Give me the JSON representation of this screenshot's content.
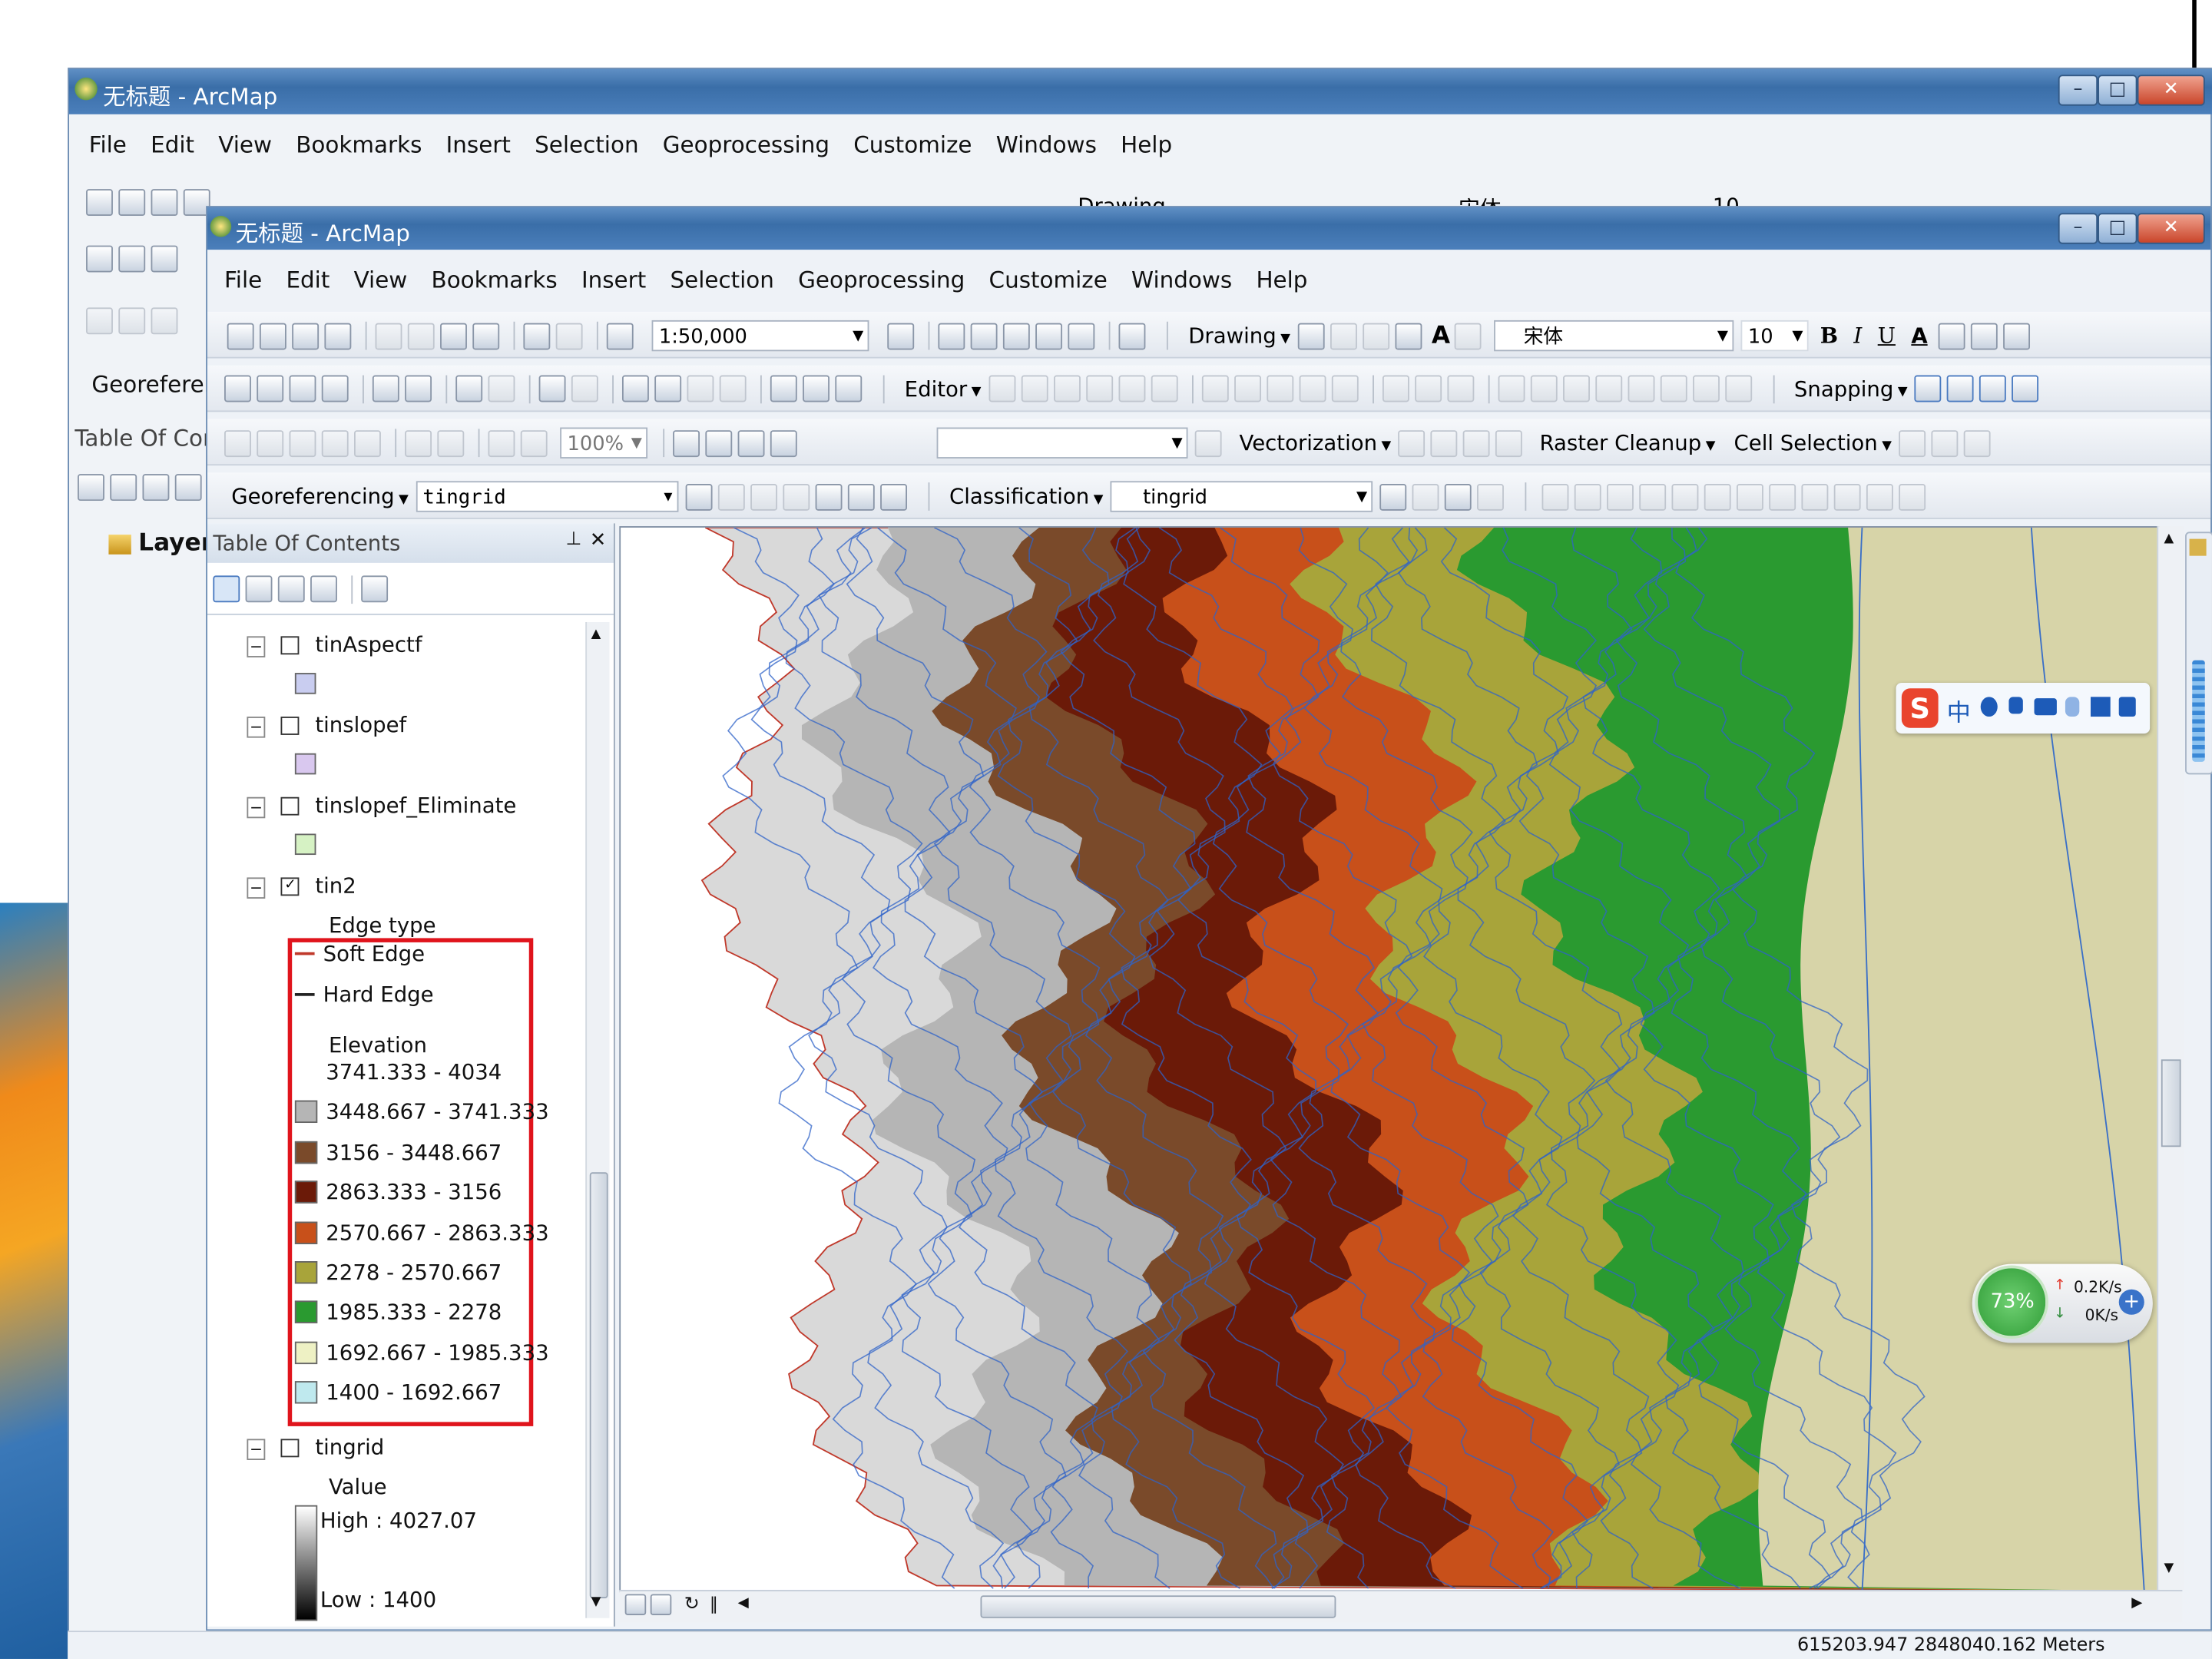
{
  "colors": {
    "title_bar": "#3a6ea8",
    "highlight_border": "#e0141c",
    "map_green": "#2f8c2a",
    "map_tan": "#d7d4a8"
  },
  "back_window": {
    "title": "无标题 - ArcMap",
    "menu": [
      "File",
      "Edit",
      "View",
      "Bookmarks",
      "Insert",
      "Selection",
      "Geoprocessing",
      "Customize",
      "Windows",
      "Help"
    ],
    "toolbar_labels": {
      "drawing": "Drawing",
      "font": "宋体",
      "size": "10"
    },
    "georef_label": "Georeferenc",
    "toc_label": "Table Of Conte",
    "layers_label": "Layers"
  },
  "window": {
    "title": "无标题 - ArcMap",
    "menu": [
      "File",
      "Edit",
      "View",
      "Bookmarks",
      "Insert",
      "Selection",
      "Geoprocessing",
      "Customize",
      "Windows",
      "Help"
    ],
    "scale": "1:50,000",
    "drawing_label": "Drawing",
    "font_name": "宋体",
    "font_size": "10",
    "bold": "B",
    "italic": "I",
    "underline": "U",
    "editor_label": "Editor",
    "snapping_label": "Snapping",
    "zoom_percent": "100%",
    "vectorization_label": "Vectorization",
    "raster_cleanup_label": "Raster Cleanup",
    "cell_selection_label": "Cell Selection",
    "georeferencing_label": "Georeferencing",
    "georef_layer": "tingrid",
    "classification_label": "Classification",
    "classification_layer": "tingrid"
  },
  "toc": {
    "title": "Table Of Contents",
    "layers": [
      {
        "name": "tinAspectf",
        "checked": false,
        "swatch": "#c9cdf0"
      },
      {
        "name": "tinslopef",
        "checked": false,
        "swatch": "#d9c8ef"
      },
      {
        "name": "tinslopef_Eliminate",
        "checked": false,
        "swatch": "#d6f2c4"
      },
      {
        "name": "tin2",
        "checked": true
      }
    ],
    "tin2": {
      "edge_header": "Edge type",
      "edges": [
        {
          "label": "Soft Edge",
          "color": "#c0392b"
        },
        {
          "label": "Hard Edge",
          "color": "#222222"
        }
      ],
      "elevation_header": "Elevation",
      "classes": [
        {
          "label": "3741.333 - 4034",
          "color": "#ffffff"
        },
        {
          "label": "3448.667 - 3741.333",
          "color": "#b5b5b5"
        },
        {
          "label": "3156 - 3448.667",
          "color": "#7a4a2a"
        },
        {
          "label": "2863.333 - 3156",
          "color": "#6b1a08"
        },
        {
          "label": "2570.667 - 2863.333",
          "color": "#c8501a"
        },
        {
          "label": "2278 - 2570.667",
          "color": "#a8a43a"
        },
        {
          "label": "1985.333 - 2278",
          "color": "#2a9a30"
        },
        {
          "label": "1692.667 - 1985.333",
          "color": "#eef1c4"
        },
        {
          "label": "1400 - 1692.667",
          "color": "#bfe9ee"
        }
      ]
    },
    "tingrid": {
      "name": "tingrid",
      "checked": false,
      "value_header": "Value",
      "high": "High : 4027.07",
      "low": "Low : 1400"
    }
  },
  "overlays": {
    "ime_text": "中",
    "speed_percent": "73%",
    "upload": "0.2K/s",
    "download": "0K/s"
  },
  "status": {
    "coordinates": "615203.947  2848040.162 Meters"
  }
}
